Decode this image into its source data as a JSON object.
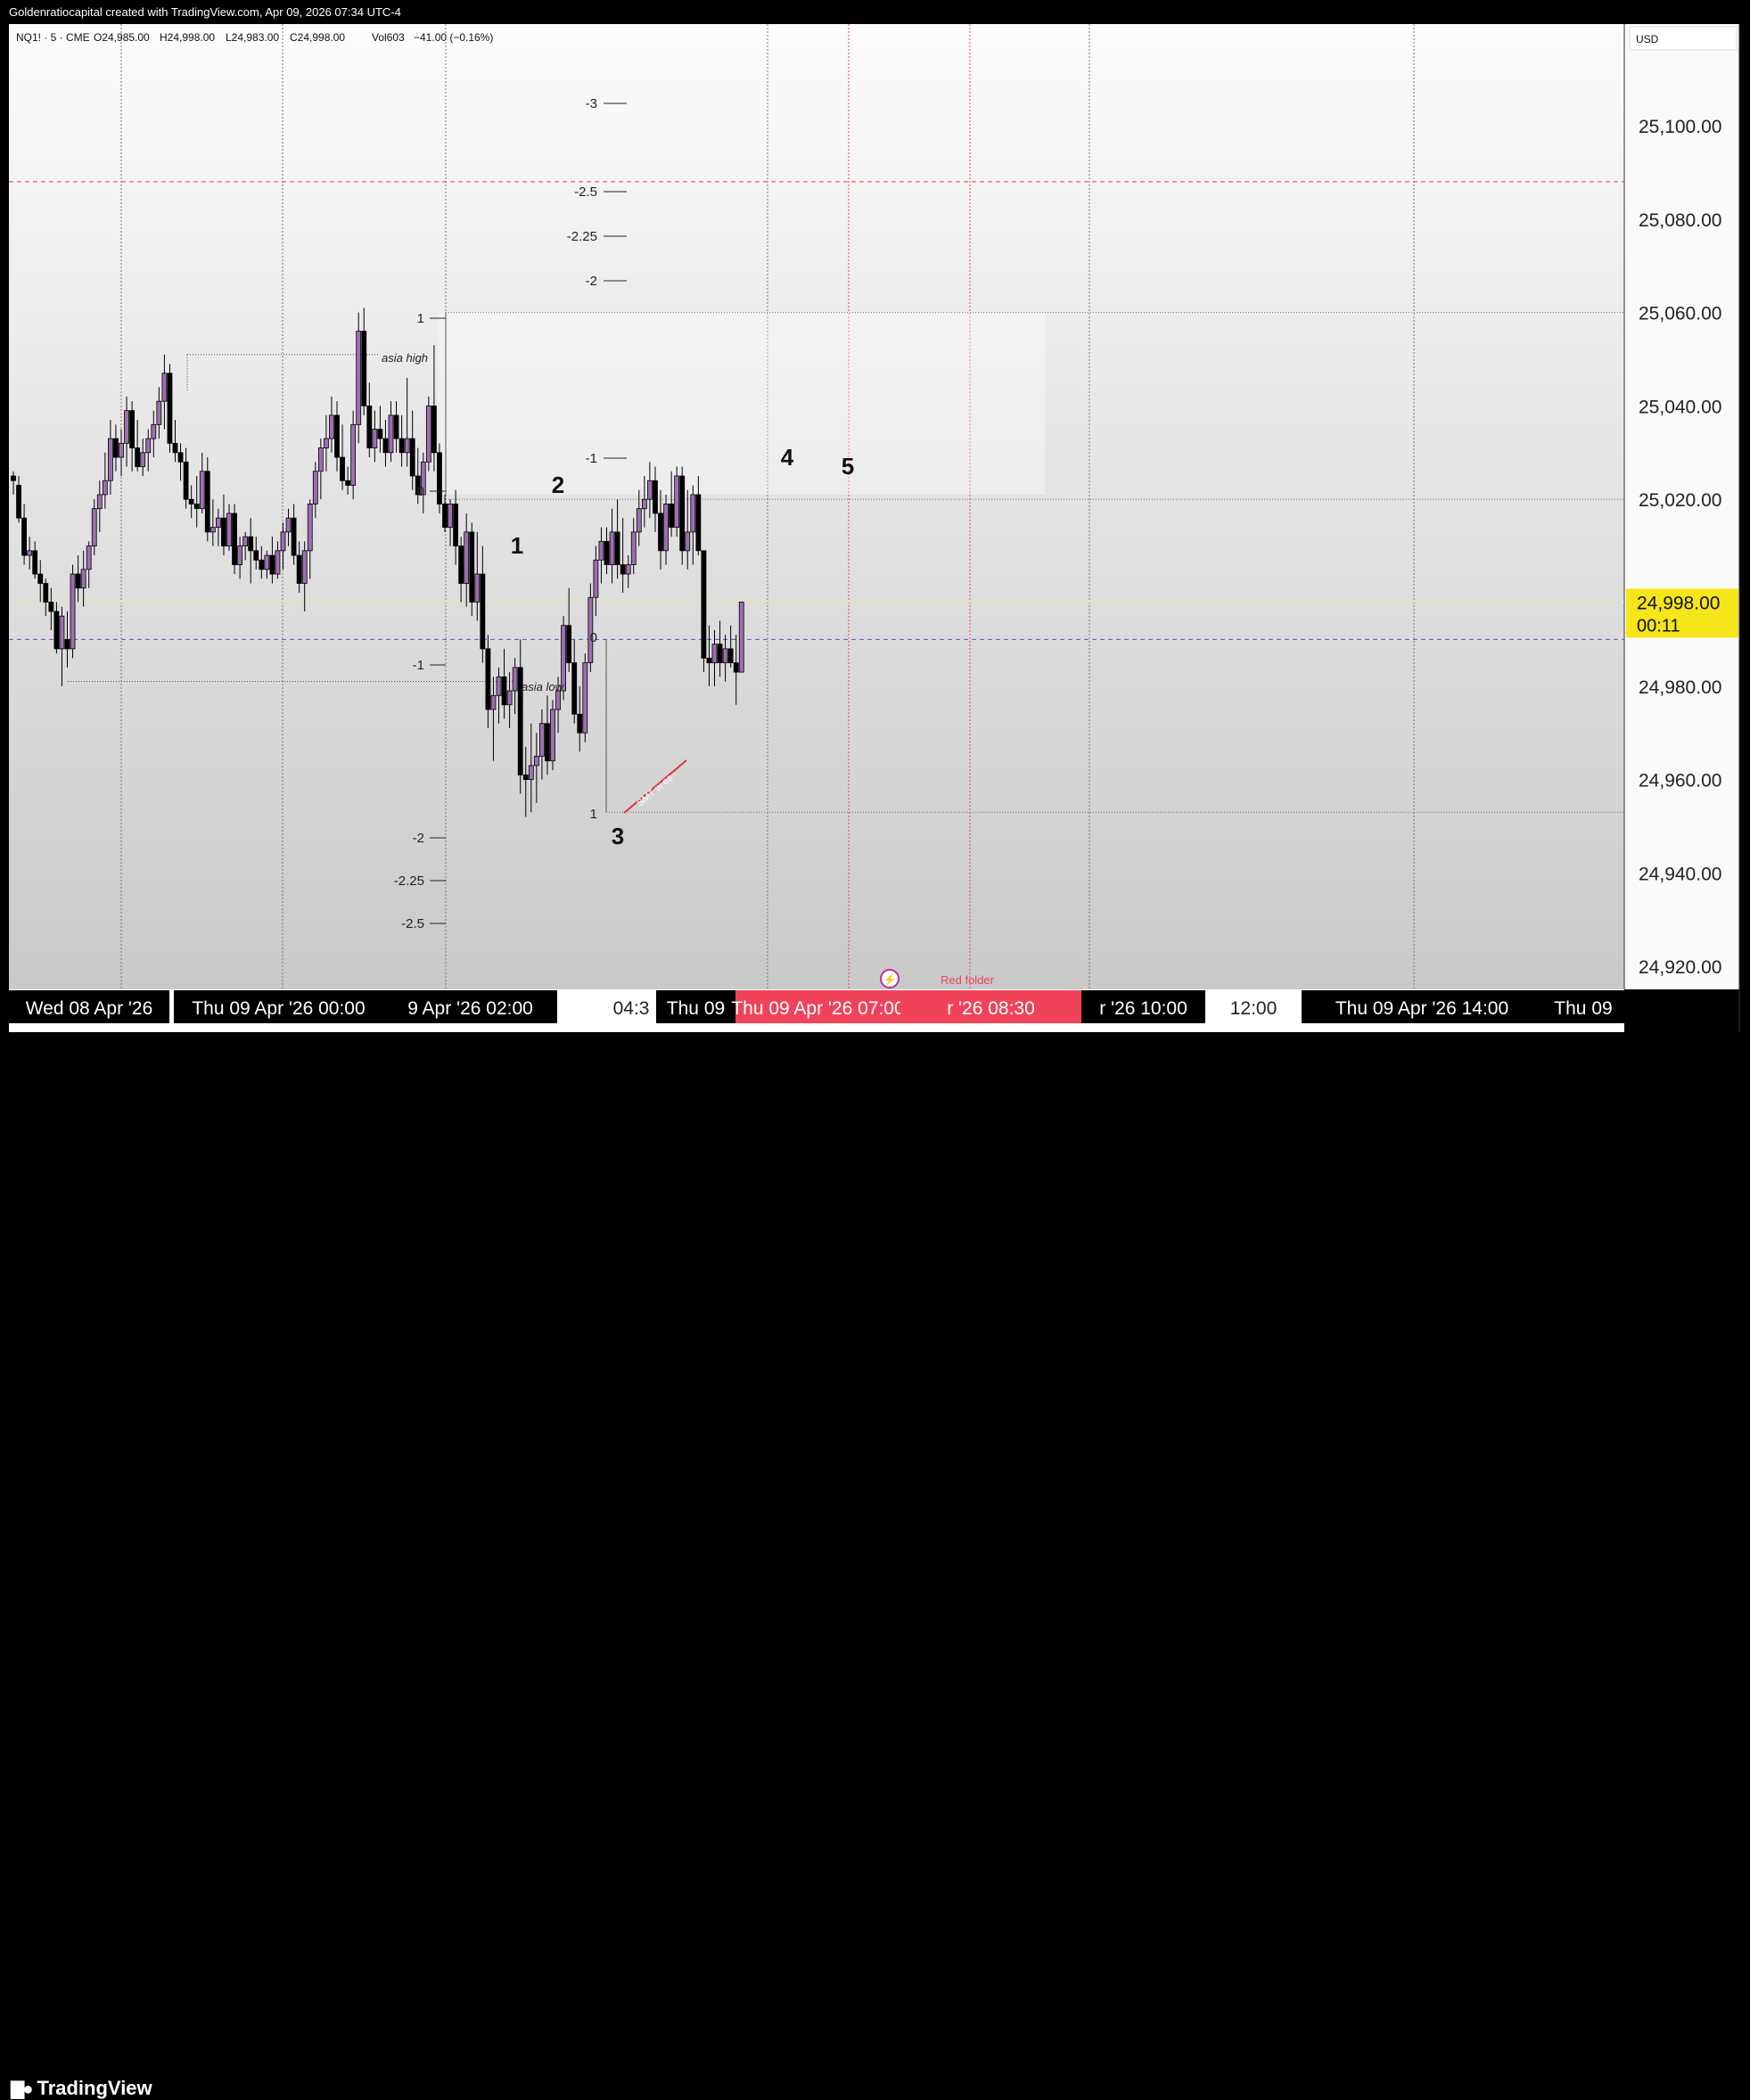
{
  "attribution": "Goldenratiocapital created with TradingView.com, Apr 09, 2026 07:34 UTC-4",
  "legend": {
    "symbol": "NQ1! · 5 · CME",
    "open": "O24,985.00",
    "high": "H24,998.00",
    "low": "L24,983.00",
    "close": "C24,998.00",
    "volume": "Vol603",
    "change": "−41.00 (−0.16%)"
  },
  "currency": "USD",
  "last_price": {
    "price": "24,998.00",
    "countdown": "00:11"
  },
  "branding": "TradingView",
  "time_axis_labels": [
    {
      "text": "Wed 08 Apr '26",
      "style": "dark"
    },
    {
      "text": "Thu 09 Apr '26   00:00",
      "style": "dark"
    },
    {
      "text": "9 Apr '26   02:00",
      "style": "dark"
    },
    {
      "text": "04:3",
      "style": "plain"
    },
    {
      "text": "Thu 09",
      "style": "dark"
    },
    {
      "text": "Thu 09 Apr '26   07:00",
      "style": "red"
    },
    {
      "text": "r '26   08:30",
      "style": "red"
    },
    {
      "text": "r '26   10:00",
      "style": "dark"
    },
    {
      "text": "12:00",
      "style": "plain"
    },
    {
      "text": "Thu 09 Apr '26   14:00",
      "style": "dark"
    },
    {
      "text": "Thu 09",
      "style": "dark"
    }
  ],
  "annotations": {
    "asia_high": "asia high",
    "asia_low": "asia low",
    "smt": "SMT w es",
    "red_folder": "Red folder",
    "wave_labels": [
      "1",
      "2",
      "3",
      "4",
      "5"
    ],
    "fib_upper": [
      "-3",
      "-2.5",
      "-2.25",
      "-2",
      "-1",
      "0",
      "1"
    ],
    "fib_lower": [
      "0",
      "1",
      "-1",
      "-2",
      "-2.25",
      "-2.5"
    ]
  },
  "colors": {
    "up_candle": "#9c6fb0",
    "down_candle": "#000000",
    "last_price_tag": "#f5e51a",
    "red_event": "#f0435a",
    "blue_dashed": "#3f5bd9",
    "red_dashed": "#e0404a"
  },
  "chart_data": {
    "type": "candlestick",
    "symbol": "NQ1!",
    "timeframe": "5",
    "y_axis": {
      "ticks": [
        25100,
        25080,
        25060,
        25040,
        25020,
        25000,
        24980,
        24960,
        24940,
        24920
      ],
      "tick_labels": [
        "25,100.00",
        "25,080.00",
        "25,060.00",
        "25,040.00",
        "25,020.00",
        "",
        "24,980.00",
        "24,960.00",
        "24,940.00",
        "24,920.00"
      ],
      "range": [
        24915,
        25122
      ]
    },
    "reference_lines": {
      "red_dashed": 25088,
      "blue_dashed": 24990,
      "fib_top_high": 25060,
      "fib_top_low": 25021,
      "fib_bottom_high": 24990,
      "fib_bottom_low": 24953,
      "asia_high": 25051,
      "asia_low": 24981
    },
    "candles": [
      [
        25025,
        25026,
        25021,
        25024
      ],
      [
        25023,
        25025,
        25015,
        25016
      ],
      [
        25016,
        25019,
        25006,
        25008
      ],
      [
        25008,
        25012,
        25005,
        25009
      ],
      [
        25009,
        25011,
        25003,
        25004
      ],
      [
        25004,
        25007,
        24998,
        25002
      ],
      [
        25002,
        25003,
        24995,
        24998
      ],
      [
        24998,
        25001,
        24992,
        24996
      ],
      [
        24996,
        24998,
        24987,
        24988
      ],
      [
        24988,
        24997,
        24980,
        24995
      ],
      [
        24990,
        24996,
        24984,
        24988
      ],
      [
        24988,
        25006,
        24986,
        25004
      ],
      [
        25004,
        25008,
        24998,
        25001
      ],
      [
        25001,
        25009,
        24997,
        25005
      ],
      [
        25005,
        25011,
        25001,
        25010
      ],
      [
        25010,
        25020,
        25008,
        25018
      ],
      [
        25018,
        25024,
        25013,
        25021
      ],
      [
        25021,
        25030,
        25018,
        25024
      ],
      [
        25024,
        25037,
        25021,
        25033
      ],
      [
        25033,
        25036,
        25026,
        25029
      ],
      [
        25029,
        25035,
        25025,
        25032
      ],
      [
        25032,
        25042,
        25027,
        25039
      ],
      [
        25039,
        25041,
        25026,
        25031
      ],
      [
        25031,
        25037,
        25026,
        25027
      ],
      [
        25027,
        25033,
        25025,
        25030
      ],
      [
        25030,
        25035,
        25026,
        25033
      ],
      [
        25033,
        25039,
        25029,
        25036
      ],
      [
        25036,
        25044,
        25033,
        25041
      ],
      [
        25041,
        25051,
        25035,
        25047
      ],
      [
        25047,
        25049,
        25030,
        25032
      ],
      [
        25032,
        25037,
        25028,
        25030
      ],
      [
        25030,
        25032,
        25024,
        25028
      ],
      [
        25028,
        25031,
        25018,
        25020
      ],
      [
        25020,
        25023,
        25016,
        25019
      ],
      [
        25019,
        25025,
        25014,
        25018
      ],
      [
        25018,
        25030,
        25017,
        25026
      ],
      [
        25026,
        25029,
        25011,
        25013
      ],
      [
        25013,
        25020,
        25010,
        25014
      ],
      [
        25014,
        25018,
        25010,
        25016
      ],
      [
        25016,
        25021,
        25008,
        25010
      ],
      [
        25010,
        25019,
        25009,
        25017
      ],
      [
        25017,
        25019,
        25004,
        25006
      ],
      [
        25006,
        25012,
        25003,
        25010
      ],
      [
        25010,
        25013,
        25007,
        25012
      ],
      [
        25012,
        25016,
        25002,
        25009
      ],
      [
        25009,
        25012,
        25005,
        25007
      ],
      [
        25007,
        25010,
        25003,
        25005
      ],
      [
        25005,
        25009,
        25003,
        25008
      ],
      [
        25008,
        25012,
        25002,
        25004
      ],
      [
        25004,
        25011,
        25003,
        25009
      ],
      [
        25009,
        25015,
        25005,
        25013
      ],
      [
        25013,
        25018,
        25010,
        25016
      ],
      [
        25016,
        25019,
        25006,
        25008
      ],
      [
        25008,
        25011,
        25000,
        25002
      ],
      [
        25002,
        25011,
        24996,
        25009
      ],
      [
        25009,
        25020,
        25003,
        25019
      ],
      [
        25019,
        25028,
        25016,
        25026
      ],
      [
        25026,
        25033,
        25020,
        25031
      ],
      [
        25031,
        25038,
        25026,
        25033
      ],
      [
        25033,
        25042,
        25030,
        25038
      ],
      [
        25038,
        25041,
        25026,
        25029
      ],
      [
        25029,
        25036,
        25022,
        25024
      ],
      [
        25024,
        25027,
        25021,
        25023
      ],
      [
        25023,
        25039,
        25020,
        25036
      ],
      [
        25036,
        25060,
        25032,
        25056
      ],
      [
        25056,
        25061,
        25038,
        25040
      ],
      [
        25040,
        25045,
        25029,
        25031
      ],
      [
        25031,
        25039,
        25028,
        25035
      ],
      [
        25035,
        25040,
        25030,
        25033
      ],
      [
        25033,
        25037,
        25027,
        25030
      ],
      [
        25030,
        25041,
        25028,
        25038
      ],
      [
        25038,
        25041,
        25030,
        25033
      ],
      [
        25033,
        25038,
        25027,
        25030
      ],
      [
        25030,
        25046,
        25027,
        25033
      ],
      [
        25033,
        25039,
        25022,
        25025
      ],
      [
        25025,
        25031,
        25019,
        25021
      ],
      [
        25021,
        25030,
        25017,
        25028
      ],
      [
        25028,
        25042,
        25026,
        25040
      ],
      [
        25040,
        25053,
        25026,
        25030
      ],
      [
        25030,
        25032,
        25017,
        25019
      ],
      [
        25019,
        25021,
        25013,
        25014
      ],
      [
        25014,
        25020,
        25010,
        25019
      ],
      [
        25019,
        25022,
        25006,
        25010
      ],
      [
        25010,
        25012,
        24998,
        25002
      ],
      [
        25002,
        25017,
        24997,
        25013
      ],
      [
        25013,
        25015,
        24995,
        24998
      ],
      [
        24998,
        25013,
        24994,
        25004
      ],
      [
        25004,
        25010,
        24985,
        24988
      ],
      [
        24988,
        24991,
        24971,
        24975
      ],
      [
        24975,
        24982,
        24964,
        24978
      ],
      [
        24978,
        24984,
        24972,
        24982
      ],
      [
        24982,
        24988,
        24973,
        24976
      ],
      [
        24976,
        24983,
        24971,
        24979
      ],
      [
        24979,
        24986,
        24974,
        24984
      ],
      [
        24984,
        24990,
        24957,
        24961
      ],
      [
        24961,
        24967,
        24952,
        24960
      ],
      [
        24960,
        24972,
        24953,
        24963
      ],
      [
        24963,
        24970,
        24955,
        24965
      ],
      [
        24965,
        24975,
        24960,
        24972
      ],
      [
        24972,
        24978,
        24961,
        24964
      ],
      [
        24964,
        24977,
        24962,
        24975
      ],
      [
        24975,
        24982,
        24970,
        24979
      ],
      [
        24979,
        24995,
        24977,
        24993
      ],
      [
        24993,
        25001,
        24983,
        24985
      ],
      [
        24985,
        24990,
        24972,
        24974
      ],
      [
        24974,
        24980,
        24966,
        24970
      ],
      [
        24970,
        24987,
        24968,
        24985
      ],
      [
        24985,
        25002,
        24983,
        24999
      ],
      [
        24999,
        25010,
        24995,
        25007
      ],
      [
        25007,
        25014,
        25002,
        25011
      ],
      [
        25011,
        25014,
        25004,
        25006
      ],
      [
        25006,
        25018,
        25002,
        25013
      ],
      [
        25013,
        25020,
        25003,
        25006
      ],
      [
        25006,
        25016,
        25000,
        25004
      ],
      [
        25004,
        25008,
        25001,
        25006
      ],
      [
        25006,
        25016,
        25004,
        25013
      ],
      [
        25013,
        25022,
        25010,
        25018
      ],
      [
        25018,
        25025,
        25014,
        25020
      ],
      [
        25020,
        25028,
        25016,
        25024
      ],
      [
        25024,
        25027,
        25013,
        25017
      ],
      [
        25017,
        25022,
        25005,
        25009
      ],
      [
        25009,
        25021,
        25006,
        25019
      ],
      [
        25019,
        25026,
        25012,
        25014
      ],
      [
        25014,
        25027,
        25012,
        25025
      ],
      [
        25025,
        25027,
        25006,
        25009
      ],
      [
        25009,
        25022,
        25005,
        25013
      ],
      [
        25013,
        25023,
        25006,
        25021
      ],
      [
        25021,
        25025,
        25008,
        25009
      ],
      [
        25009,
        24999,
        24983,
        24986
      ],
      [
        24986,
        24993,
        24980,
        24985
      ],
      [
        24985,
        24992,
        24980,
        24989
      ],
      [
        24989,
        24994,
        24982,
        24985
      ],
      [
        24985,
        24991,
        24981,
        24988
      ],
      [
        24988,
        24993,
        24984,
        24985
      ],
      [
        24985,
        24991,
        24976,
        24983
      ],
      [
        24983,
        24998,
        24983,
        24998
      ]
    ]
  }
}
